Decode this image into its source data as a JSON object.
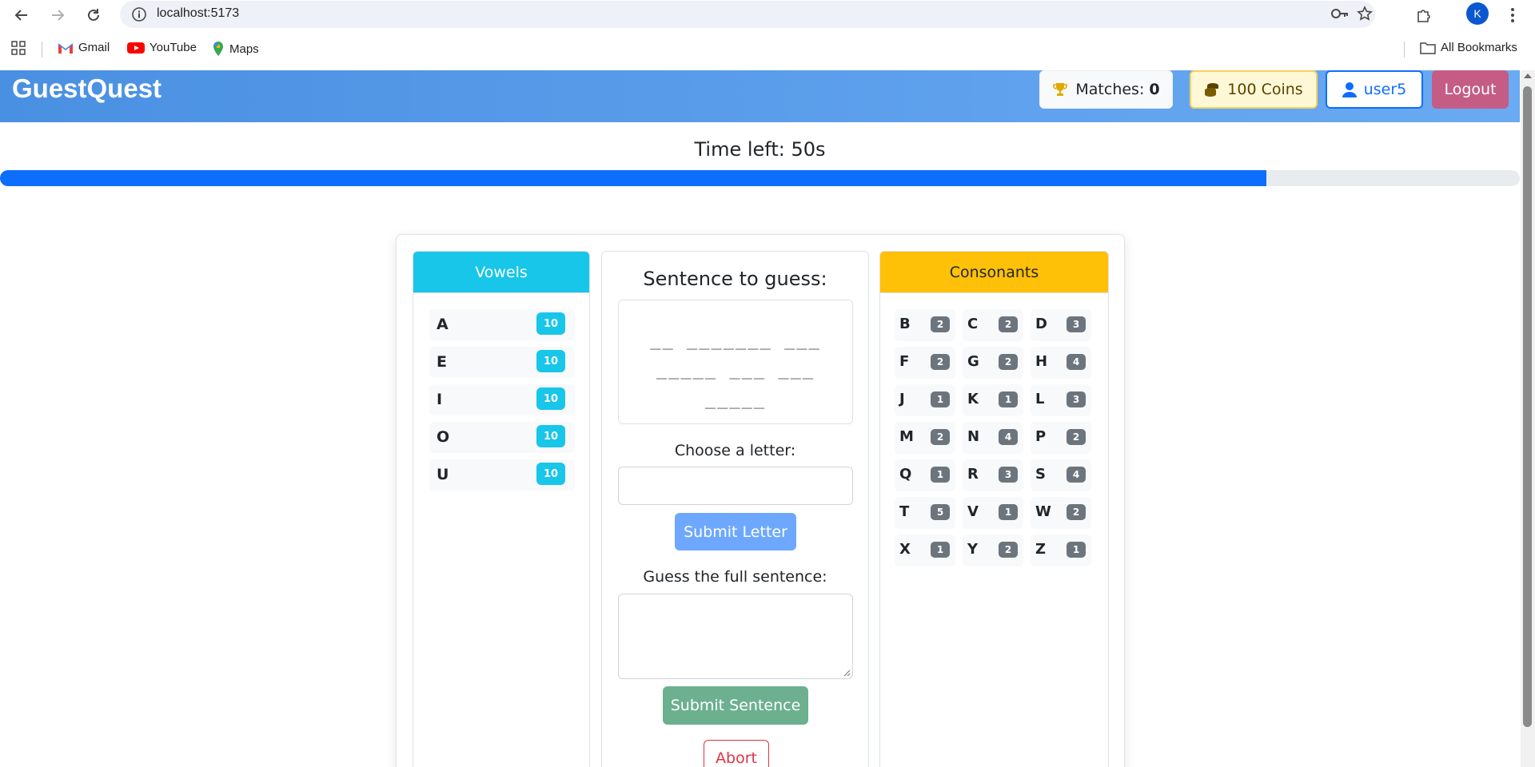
{
  "browser": {
    "url": "localhost:5173",
    "profile_initial": "K",
    "bookmarks": [
      {
        "label": "Gmail",
        "icon": "gmail-icon"
      },
      {
        "label": "YouTube",
        "icon": "youtube-icon"
      },
      {
        "label": "Maps",
        "icon": "maps-icon"
      }
    ],
    "all_bookmarks_label": "All Bookmarks"
  },
  "header": {
    "brand": "GuestQuest",
    "matches_label": "Matches:",
    "matches_value": "0",
    "coins_label": "100 Coins",
    "user_label": "user5",
    "logout_label": "Logout",
    "colors": {
      "gradient_start": "#4a90e2",
      "gradient_end": "#6aaaf2",
      "logout": "#c45c86"
    }
  },
  "timer": {
    "label": "Time left: 50s",
    "progress_fraction": 0.833
  },
  "vowels": {
    "title": "Vowels",
    "items": [
      {
        "letter": "A",
        "cost": "10"
      },
      {
        "letter": "E",
        "cost": "10"
      },
      {
        "letter": "I",
        "cost": "10"
      },
      {
        "letter": "O",
        "cost": "10"
      },
      {
        "letter": "U",
        "cost": "10"
      }
    ]
  },
  "middle": {
    "title": "Sentence to guess:",
    "masked_lines": [
      "__ _______ ___",
      "_____ ___ ___",
      "_____"
    ],
    "letter_label": "Choose a letter:",
    "letter_value": "",
    "submit_letter": "Submit Letter",
    "sentence_label": "Guess the full sentence:",
    "sentence_value": "",
    "submit_sentence": "Submit Sentence",
    "abort": "Abort"
  },
  "consonants": {
    "title": "Consonants",
    "items": [
      {
        "letter": "B",
        "cost": "2"
      },
      {
        "letter": "C",
        "cost": "2"
      },
      {
        "letter": "D",
        "cost": "3"
      },
      {
        "letter": "F",
        "cost": "2"
      },
      {
        "letter": "G",
        "cost": "2"
      },
      {
        "letter": "H",
        "cost": "4"
      },
      {
        "letter": "J",
        "cost": "1"
      },
      {
        "letter": "K",
        "cost": "1"
      },
      {
        "letter": "L",
        "cost": "3"
      },
      {
        "letter": "M",
        "cost": "2"
      },
      {
        "letter": "N",
        "cost": "4"
      },
      {
        "letter": "P",
        "cost": "2"
      },
      {
        "letter": "Q",
        "cost": "1"
      },
      {
        "letter": "R",
        "cost": "3"
      },
      {
        "letter": "S",
        "cost": "4"
      },
      {
        "letter": "T",
        "cost": "5"
      },
      {
        "letter": "V",
        "cost": "1"
      },
      {
        "letter": "W",
        "cost": "2"
      },
      {
        "letter": "X",
        "cost": "1"
      },
      {
        "letter": "Y",
        "cost": "2"
      },
      {
        "letter": "Z",
        "cost": "1"
      }
    ]
  }
}
